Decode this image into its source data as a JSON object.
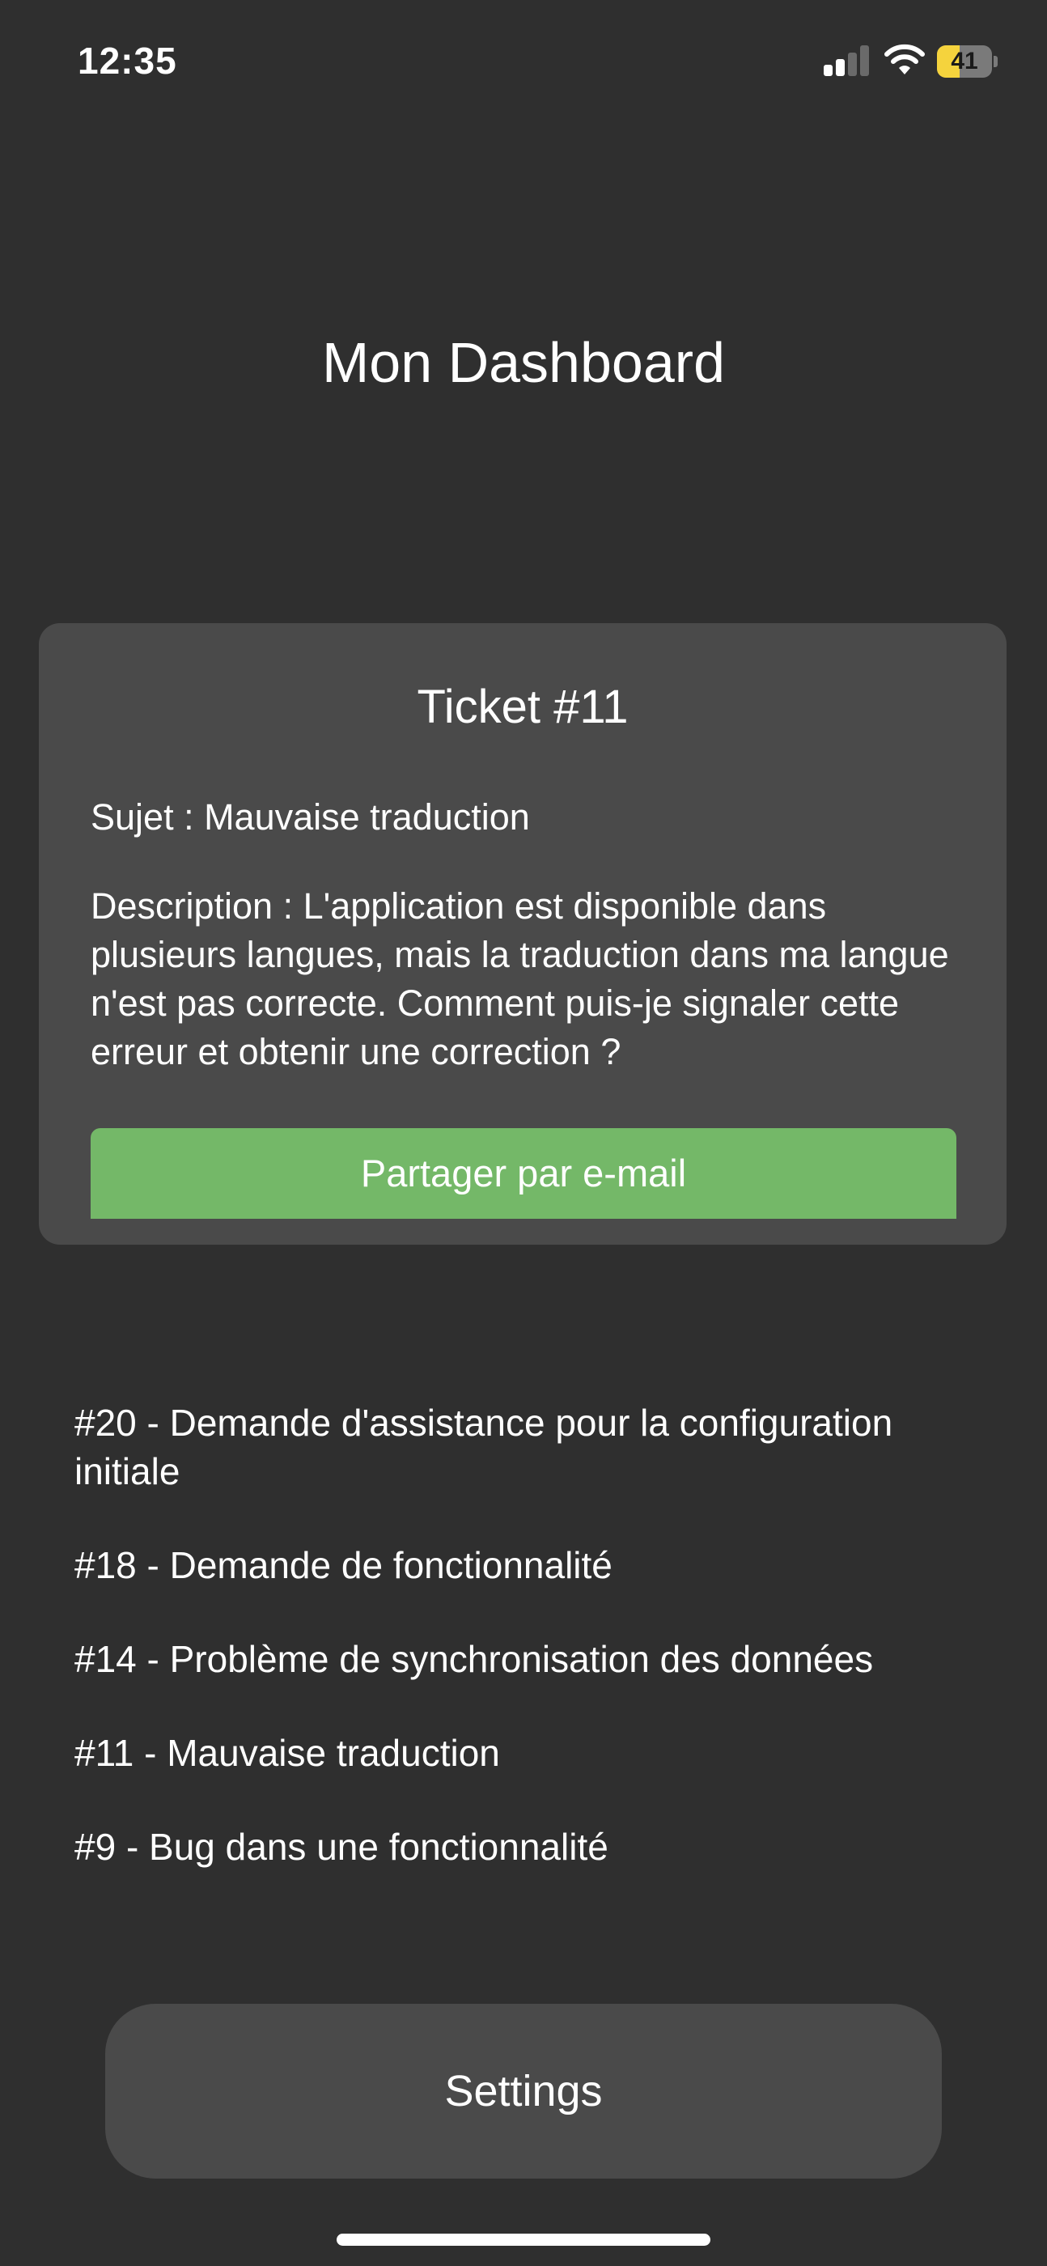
{
  "status_bar": {
    "time": "12:35",
    "battery_level": "41",
    "battery_fraction": 0.41,
    "icons": [
      "signal-icon",
      "wifi-icon",
      "battery-icon"
    ]
  },
  "header": {
    "title": "Mon Dashboard"
  },
  "ticket_card": {
    "title": "Ticket #11",
    "subject": "Sujet : Mauvaise traduction",
    "description": "Description : L'application est disponible dans plusieurs langues, mais la traduction dans ma langue n'est pas correcte. Comment puis-je signaler cette erreur et obtenir une correction ?",
    "share_label": "Partager par e-mail"
  },
  "ticket_list": {
    "items": [
      {
        "label": "#20 - Demande d'assistance pour la configuration initiale"
      },
      {
        "label": "#18 - Demande de fonctionnalité"
      },
      {
        "label": "#14 - Problème de synchronisation des données"
      },
      {
        "label": "#11 - Mauvaise traduction"
      },
      {
        "label": "#9 - Bug dans une fonctionnalité"
      }
    ]
  },
  "footer": {
    "settings_label": "Settings"
  },
  "colors": {
    "background": "#2f2f2f",
    "card": "#4a4a4a",
    "accent_green": "#74b868",
    "battery_yellow": "#f5d33d"
  }
}
